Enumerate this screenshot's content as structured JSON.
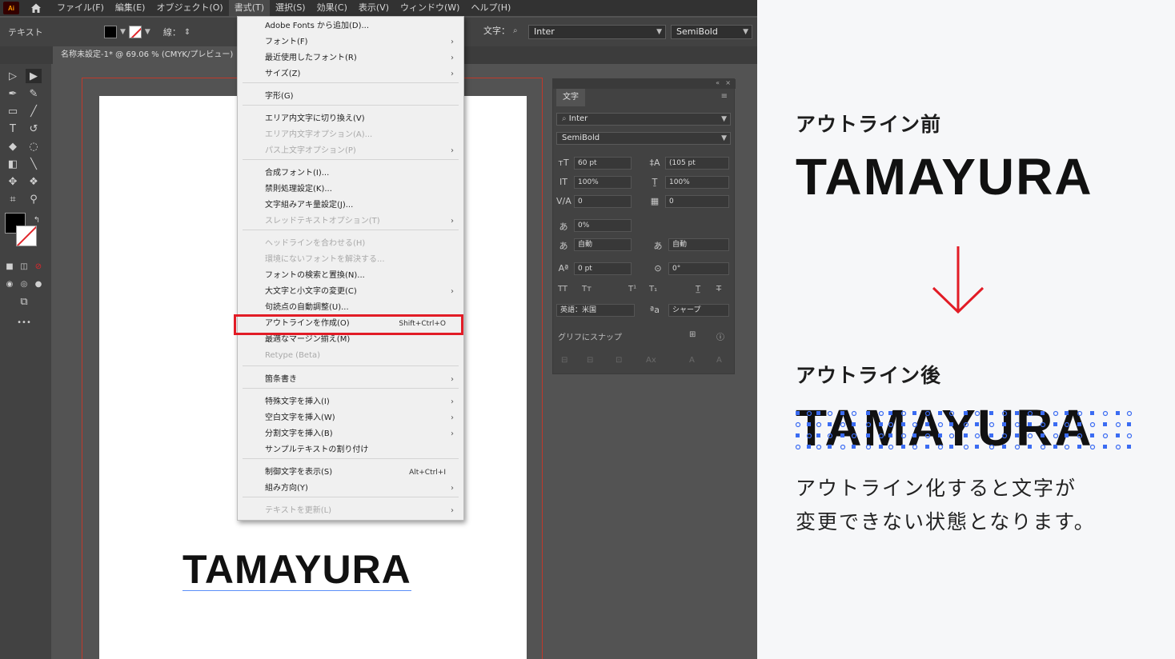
{
  "menubar": {
    "logo": "Ai",
    "items": [
      "ファイル(F)",
      "編集(E)",
      "オブジェクト(O)",
      "書式(T)",
      "選択(S)",
      "効果(C)",
      "表示(V)",
      "ウィンドウ(W)",
      "ヘルプ(H)"
    ]
  },
  "controlbar": {
    "label": "テキスト",
    "stroke_label": "線：",
    "char_label": "文字：",
    "font_value": "Inter",
    "style_value": "SemiBold"
  },
  "doc_tab": "名称未設定-1* @ 69.06 % (CMYK/プレビュー)",
  "menu": {
    "items": [
      {
        "label": "Adobe Fonts から追加(D)...",
        "arrow": false,
        "disabled": false,
        "shortcut": ""
      },
      {
        "label": "フォント(F)",
        "arrow": true,
        "disabled": false,
        "shortcut": ""
      },
      {
        "label": "最近使用したフォント(R)",
        "arrow": true,
        "disabled": false,
        "shortcut": ""
      },
      {
        "label": "サイズ(Z)",
        "arrow": true,
        "disabled": false,
        "shortcut": ""
      },
      {
        "label": "字形(G)",
        "arrow": false,
        "disabled": false,
        "shortcut": ""
      },
      {
        "label": "エリア内文字に切り換え(V)",
        "arrow": false,
        "disabled": false,
        "shortcut": ""
      },
      {
        "label": "エリア内文字オプション(A)...",
        "arrow": false,
        "disabled": true,
        "shortcut": ""
      },
      {
        "label": "パス上文字オプション(P)",
        "arrow": true,
        "disabled": true,
        "shortcut": ""
      },
      {
        "label": "合成フォント(I)...",
        "arrow": false,
        "disabled": false,
        "shortcut": ""
      },
      {
        "label": "禁則処理設定(K)...",
        "arrow": false,
        "disabled": false,
        "shortcut": ""
      },
      {
        "label": "文字組みアキ量設定(J)...",
        "arrow": false,
        "disabled": false,
        "shortcut": ""
      },
      {
        "label": "スレッドテキストオプション(T)",
        "arrow": true,
        "disabled": true,
        "shortcut": ""
      },
      {
        "label": "ヘッドラインを合わせる(H)",
        "arrow": false,
        "disabled": true,
        "shortcut": ""
      },
      {
        "label": "環境にないフォントを解決する...",
        "arrow": false,
        "disabled": true,
        "shortcut": ""
      },
      {
        "label": "フォントの検索と置換(N)...",
        "arrow": false,
        "disabled": false,
        "shortcut": ""
      },
      {
        "label": "大文字と小文字の変更(C)",
        "arrow": true,
        "disabled": false,
        "shortcut": ""
      },
      {
        "label": "句読点の自動調整(U)...",
        "arrow": false,
        "disabled": false,
        "shortcut": ""
      },
      {
        "label": "アウトラインを作成(O)",
        "arrow": false,
        "disabled": false,
        "shortcut": "Shift+Ctrl+O"
      },
      {
        "label": "最適なマージン揃え(M)",
        "arrow": false,
        "disabled": false,
        "shortcut": ""
      },
      {
        "label": "Retype (Beta)",
        "arrow": false,
        "disabled": true,
        "shortcut": ""
      },
      {
        "label": "箇条書き",
        "arrow": true,
        "disabled": false,
        "shortcut": ""
      },
      {
        "label": "特殊文字を挿入(I)",
        "arrow": true,
        "disabled": false,
        "shortcut": ""
      },
      {
        "label": "空白文字を挿入(W)",
        "arrow": true,
        "disabled": false,
        "shortcut": ""
      },
      {
        "label": "分割文字を挿入(B)",
        "arrow": true,
        "disabled": false,
        "shortcut": ""
      },
      {
        "label": "サンプルテキストの割り付け",
        "arrow": false,
        "disabled": false,
        "shortcut": ""
      },
      {
        "label": "制御文字を表示(S)",
        "arrow": false,
        "disabled": false,
        "shortcut": "Alt+Ctrl+I"
      },
      {
        "label": "組み方向(Y)",
        "arrow": true,
        "disabled": false,
        "shortcut": ""
      },
      {
        "label": "テキストを更新(L)",
        "arrow": true,
        "disabled": true,
        "shortcut": ""
      }
    ]
  },
  "char_panel": {
    "tab": "文字",
    "font": "Inter",
    "style": "SemiBold",
    "size": "60 pt",
    "leading": "(105 pt",
    "vscale": "100%",
    "hscale": "100%",
    "kerning": "0",
    "tracking": "0",
    "tsume": "0%",
    "aki_left": "自動",
    "aki_right": "自動",
    "baseline": "0 pt",
    "rotation": "0°",
    "language": "英語：米国",
    "aa": "シャープ",
    "snap_label": "グリフにスナップ"
  },
  "artboard_text": "TAMAYURA",
  "explain": {
    "before_label": "アウトライン前",
    "before_word": "TAMAYURA",
    "after_label": "アウトライン後",
    "after_word": "TAMAYURA",
    "desc_line1": "アウトライン化すると文字が",
    "desc_line2": "変更できない状態となります。"
  },
  "colors": {
    "highlight": "#e21c26",
    "arrow": "#e21c26",
    "anchor": "#3b6cf2"
  }
}
